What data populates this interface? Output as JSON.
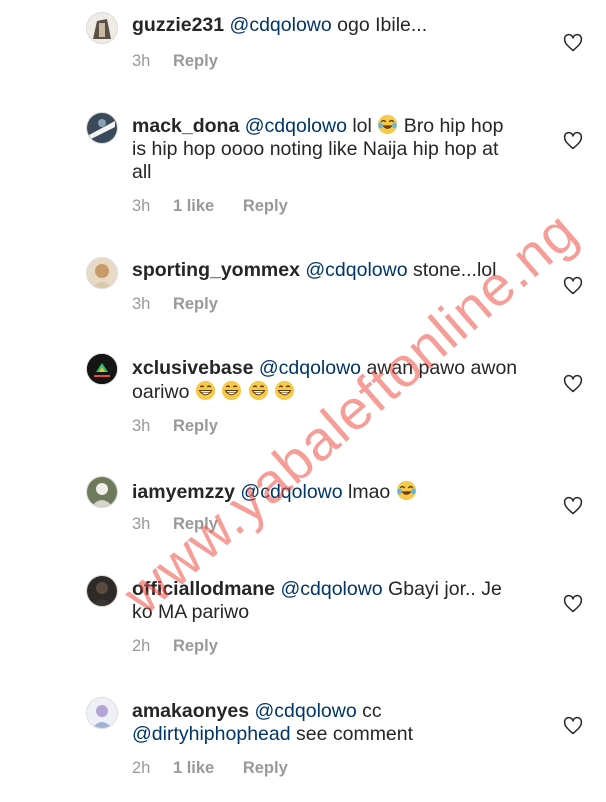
{
  "comments": [
    {
      "username": "guzzie231",
      "mention": "@cdqolowo",
      "text": " ogo Ibile...",
      "emojis": [],
      "text2": "",
      "time": "3h",
      "likes": "",
      "reply": "Reply"
    },
    {
      "username": "mack_dona",
      "mention": "@cdqolowo",
      "text": " lol ",
      "emojis": [
        "tears-of-joy"
      ],
      "text2": " Bro hip hop is hip hop oooo noting like Naija hip hop at all",
      "time": "3h",
      "likes": "1 like",
      "reply": "Reply"
    },
    {
      "username": "sporting_yommex",
      "mention": "@cdqolowo",
      "text": " stone...lol",
      "emojis": [],
      "text2": "",
      "time": "3h",
      "likes": "",
      "reply": "Reply"
    },
    {
      "username": "xclusivebase",
      "mention": "@cdqolowo",
      "text": " awan pawo awon oariwo ",
      "emojis": [
        "grin",
        "grin",
        "grin",
        "grin"
      ],
      "text2": "",
      "time": "3h",
      "likes": "",
      "reply": "Reply"
    },
    {
      "username": "iamyemzzy",
      "mention": "@cdqolowo",
      "text": " lmao ",
      "emojis": [
        "tears-of-joy"
      ],
      "text2": "",
      "time": "3h",
      "likes": "",
      "reply": "Reply"
    },
    {
      "username": "officiallodmane",
      "mention": "@cdqolowo",
      "text": " Gbayi jor.. Je ko MA pariwo",
      "emojis": [],
      "text2": "",
      "time": "2h",
      "likes": "",
      "reply": "Reply"
    },
    {
      "username": "amakaonyes",
      "mention": "@cdqolowo",
      "text": " cc ",
      "emojis": [],
      "mention2": "@dirtyhiphophead",
      "text2": " see comment",
      "time": "2h",
      "likes": "1 like",
      "reply": "Reply"
    }
  ],
  "icons": {
    "like": "heart-outline-icon"
  },
  "colors": {
    "mention": "#003569",
    "meta": "#999999",
    "watermark": "#ec4c40"
  },
  "watermark": "www.yabaleftonline.ng"
}
